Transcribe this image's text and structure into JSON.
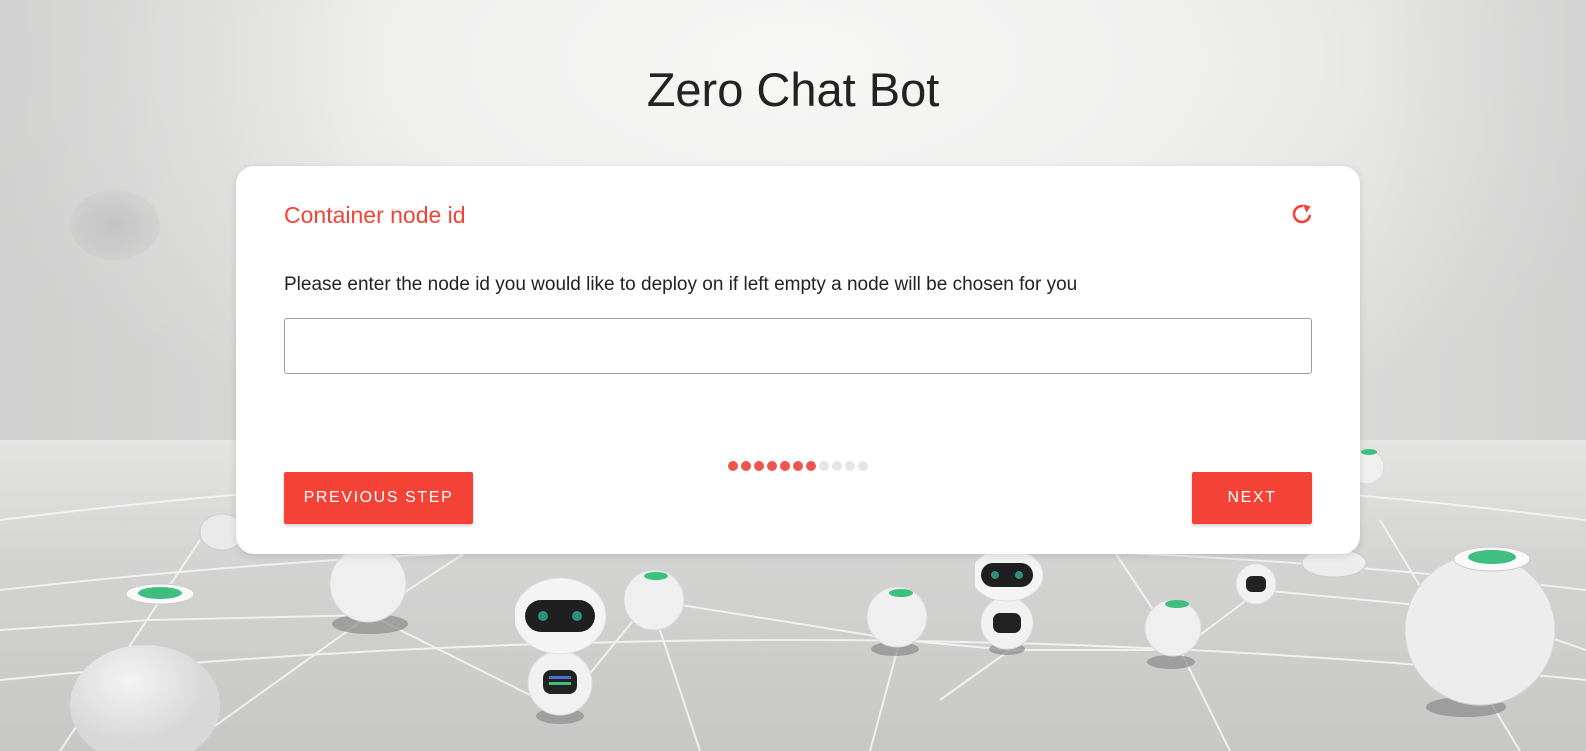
{
  "header": {
    "title": "Zero Chat Bot"
  },
  "step": {
    "title": "Container node id",
    "description": "Please enter the node id you would like to deploy on if left empty a node will be chosen for you",
    "input_value": "",
    "refresh_icon": "refresh-icon"
  },
  "progress": {
    "total_steps": 11,
    "completed_steps": 7
  },
  "actions": {
    "previous_label": "Previous step",
    "next_label": "Next"
  },
  "colors": {
    "accent": "#f44336",
    "inactive_dot": "#e6e6e6"
  }
}
